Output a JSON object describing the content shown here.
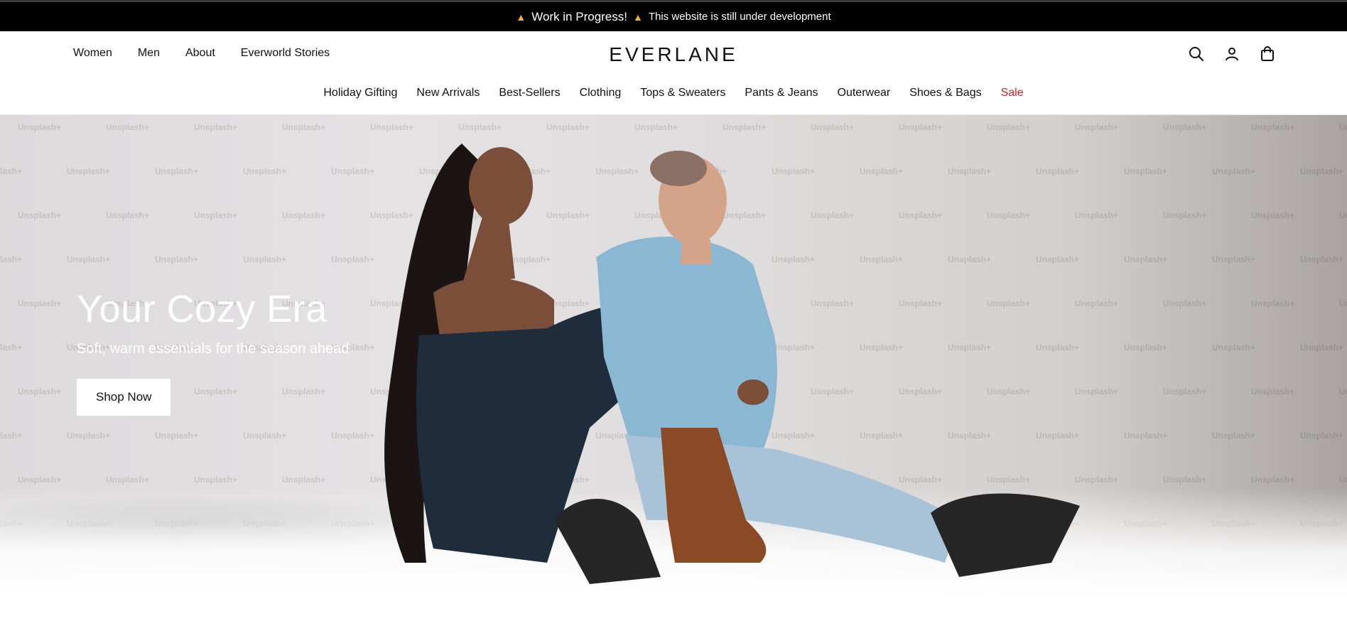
{
  "announcement": {
    "title": "Work in Progress!",
    "message": "This website is still under development",
    "icon_left": "construction-icon",
    "icon_right": "construction-icon"
  },
  "header": {
    "logo": "EVERLANE",
    "nav_left": [
      "Women",
      "Men",
      "About",
      "Everworld Stories"
    ],
    "icons": [
      "search-icon",
      "account-icon",
      "cart-icon"
    ]
  },
  "categories": [
    "Holiday Gifting",
    "New Arrivals",
    "Best-Sellers",
    "Clothing",
    "Tops & Sweaters",
    "Pants & Jeans",
    "Outerwear",
    "Shoes & Bags",
    "Sale"
  ],
  "hero": {
    "title": "Your Cozy Era",
    "subtitle": "Soft, warm essentials for the season ahead",
    "cta": "Shop Now",
    "watermark": "Unsplash+"
  },
  "colors": {
    "announcement_bg": "#000000",
    "sale": "#d62020",
    "hero_text": "#ffffff"
  }
}
